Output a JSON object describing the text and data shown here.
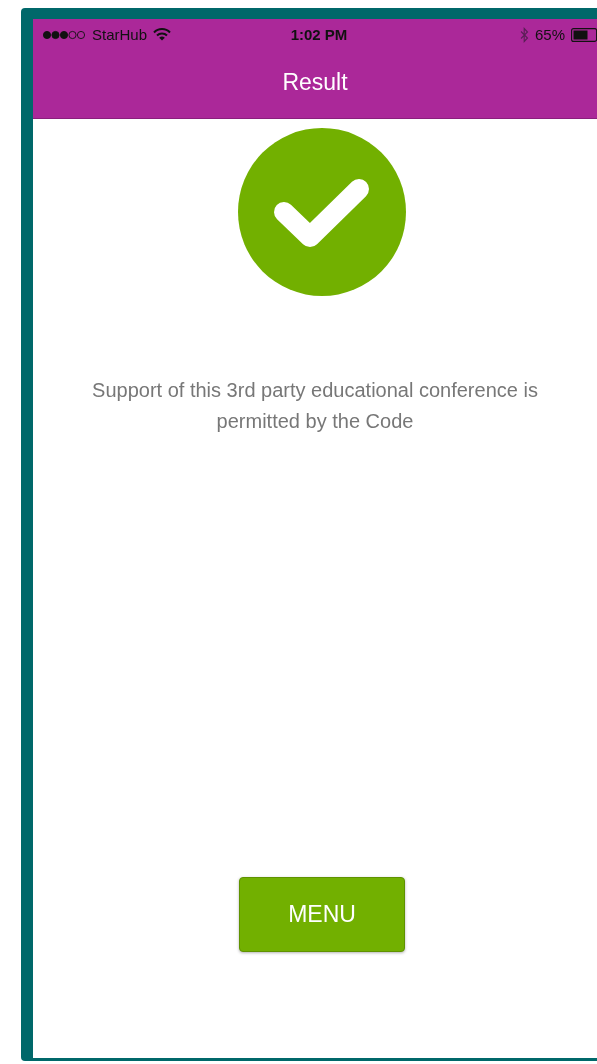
{
  "status_bar": {
    "carrier": "StarHub",
    "time": "1:02 PM",
    "battery": "65%"
  },
  "nav_bar": {
    "title": "Result"
  },
  "result": {
    "passed": true,
    "message": "Support of this 3rd party educational conference is permitted by the Code"
  },
  "buttons": [
    {
      "label": "MENU"
    }
  ]
}
